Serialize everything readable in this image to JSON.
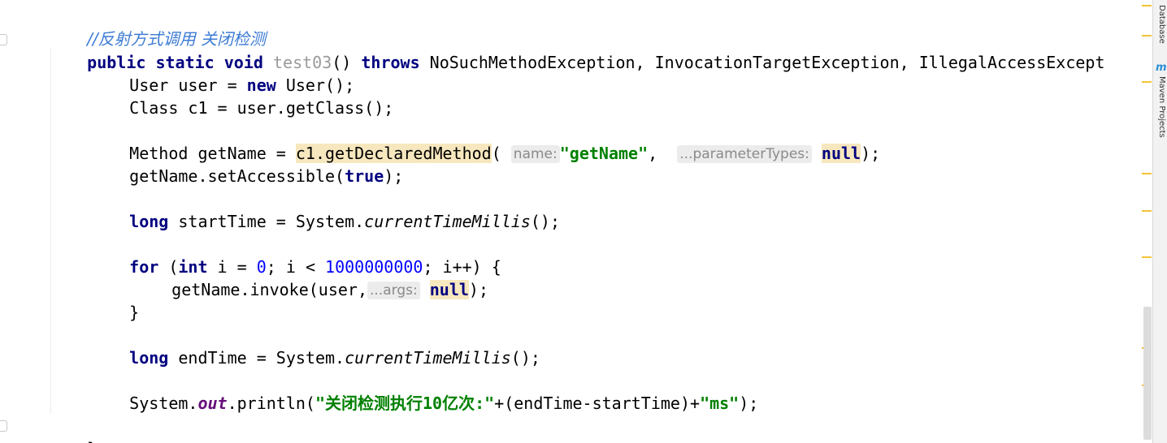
{
  "editor": {
    "lines": {
      "comment": "//反射方式调用 关闭检测",
      "signature": {
        "public": "public",
        "static": "static",
        "void": "void",
        "method_name": "test03",
        "parens": "()",
        "throws": "throws",
        "exceptions": "NoSuchMethodException, InvocationTargetException, IllegalAccessExcept"
      },
      "user_decl": {
        "text1": "User user = ",
        "new": "new",
        "text2": " User();"
      },
      "class_decl": "Class c1 = user.getClass();",
      "method_decl": {
        "text1": "Method getName = ",
        "call": "c1.getDeclaredMethod",
        "open": "(",
        "hint_name": "name:",
        "arg_string": "\"getName\"",
        "comma": ",",
        "hint_params": "...parameterTypes:",
        "null": "null",
        "close": ");"
      },
      "set_accessible": {
        "text1": "getName.setAccessible(",
        "true": "true",
        "close": ");"
      },
      "start_time": {
        "long": "long",
        "text1": " startTime = System.",
        "method": "currentTimeMillis",
        "close": "();"
      },
      "for_loop": {
        "for": "for",
        "text1": " (",
        "int": "int",
        "text2": " i = ",
        "zero": "0",
        "text3": "; i < ",
        "limit": "1000000000",
        "text4": "; i++) {"
      },
      "invoke": {
        "text1": "getName.invoke(user,",
        "hint_args": "...args:",
        "null": "null",
        "close": ");"
      },
      "close_for": "}",
      "end_time": {
        "long": "long",
        "text1": " endTime = System.",
        "method": "currentTimeMillis",
        "close": "();"
      },
      "println": {
        "text1": "System.",
        "out": "out",
        "text2": ".println(",
        "str1": "\"关闭检测执行10亿次:\"",
        "text3": "+(endTime-startTime)+",
        "str2": "\"ms\"",
        "close": ");"
      },
      "close_method": "}"
    }
  },
  "side_panel": {
    "database_tab": "Database",
    "maven_tab": "Maven Projects",
    "maven_icon": "m"
  },
  "colors": {
    "keyword": "#000080",
    "string": "#008000",
    "number": "#0000ff",
    "comment": "#3c7bd4",
    "highlight": "#f7e7be",
    "warning_mark": "#f2c438"
  }
}
